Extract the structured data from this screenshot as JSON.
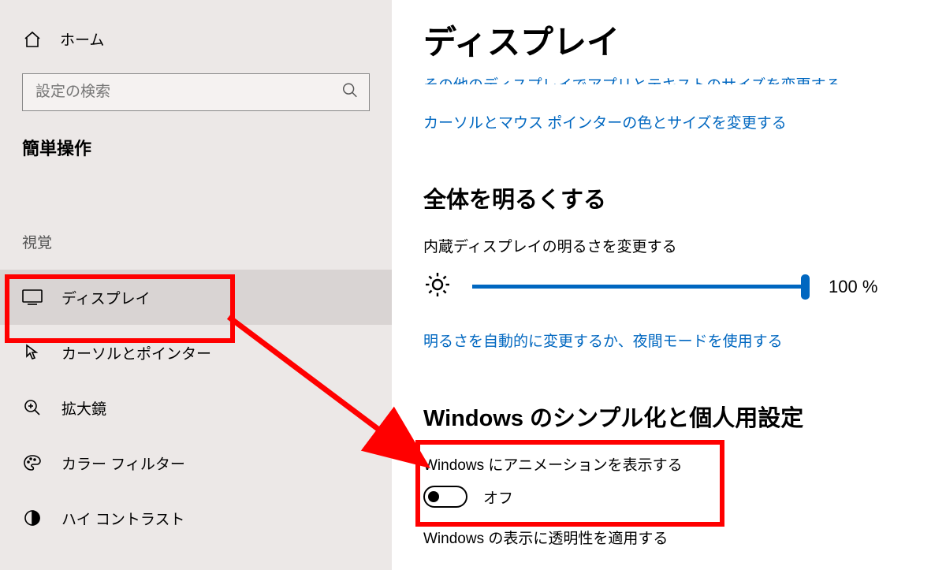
{
  "sidebar": {
    "home_label": "ホーム",
    "search_placeholder": "設定の検索",
    "category_title": "簡単操作",
    "section_label": "視覚",
    "items": [
      {
        "label": "ディスプレイ"
      },
      {
        "label": "カーソルとポインター"
      },
      {
        "label": "拡大鏡"
      },
      {
        "label": "カラー フィルター"
      },
      {
        "label": "ハイ コントラスト"
      }
    ]
  },
  "main": {
    "page_title": "ディスプレイ",
    "link_truncated_top": "その他のディスプレイでアプリとテキストのサイズを変更する",
    "link_cursor": "カーソルとマウス ポインターの色とサイズを変更する",
    "section_brightness_heading": "全体を明るくする",
    "brightness_label": "内蔵ディスプレイの明るさを変更する",
    "brightness_value": "100 %",
    "link_brightness_auto": "明るさを自動的に変更するか、夜間モードを使用する",
    "section_simplify_heading": "Windows のシンプル化と個人用設定",
    "animation_label": "Windows にアニメーションを表示する",
    "animation_state": "オフ",
    "transparency_label": "Windows の表示に透明性を適用する"
  }
}
